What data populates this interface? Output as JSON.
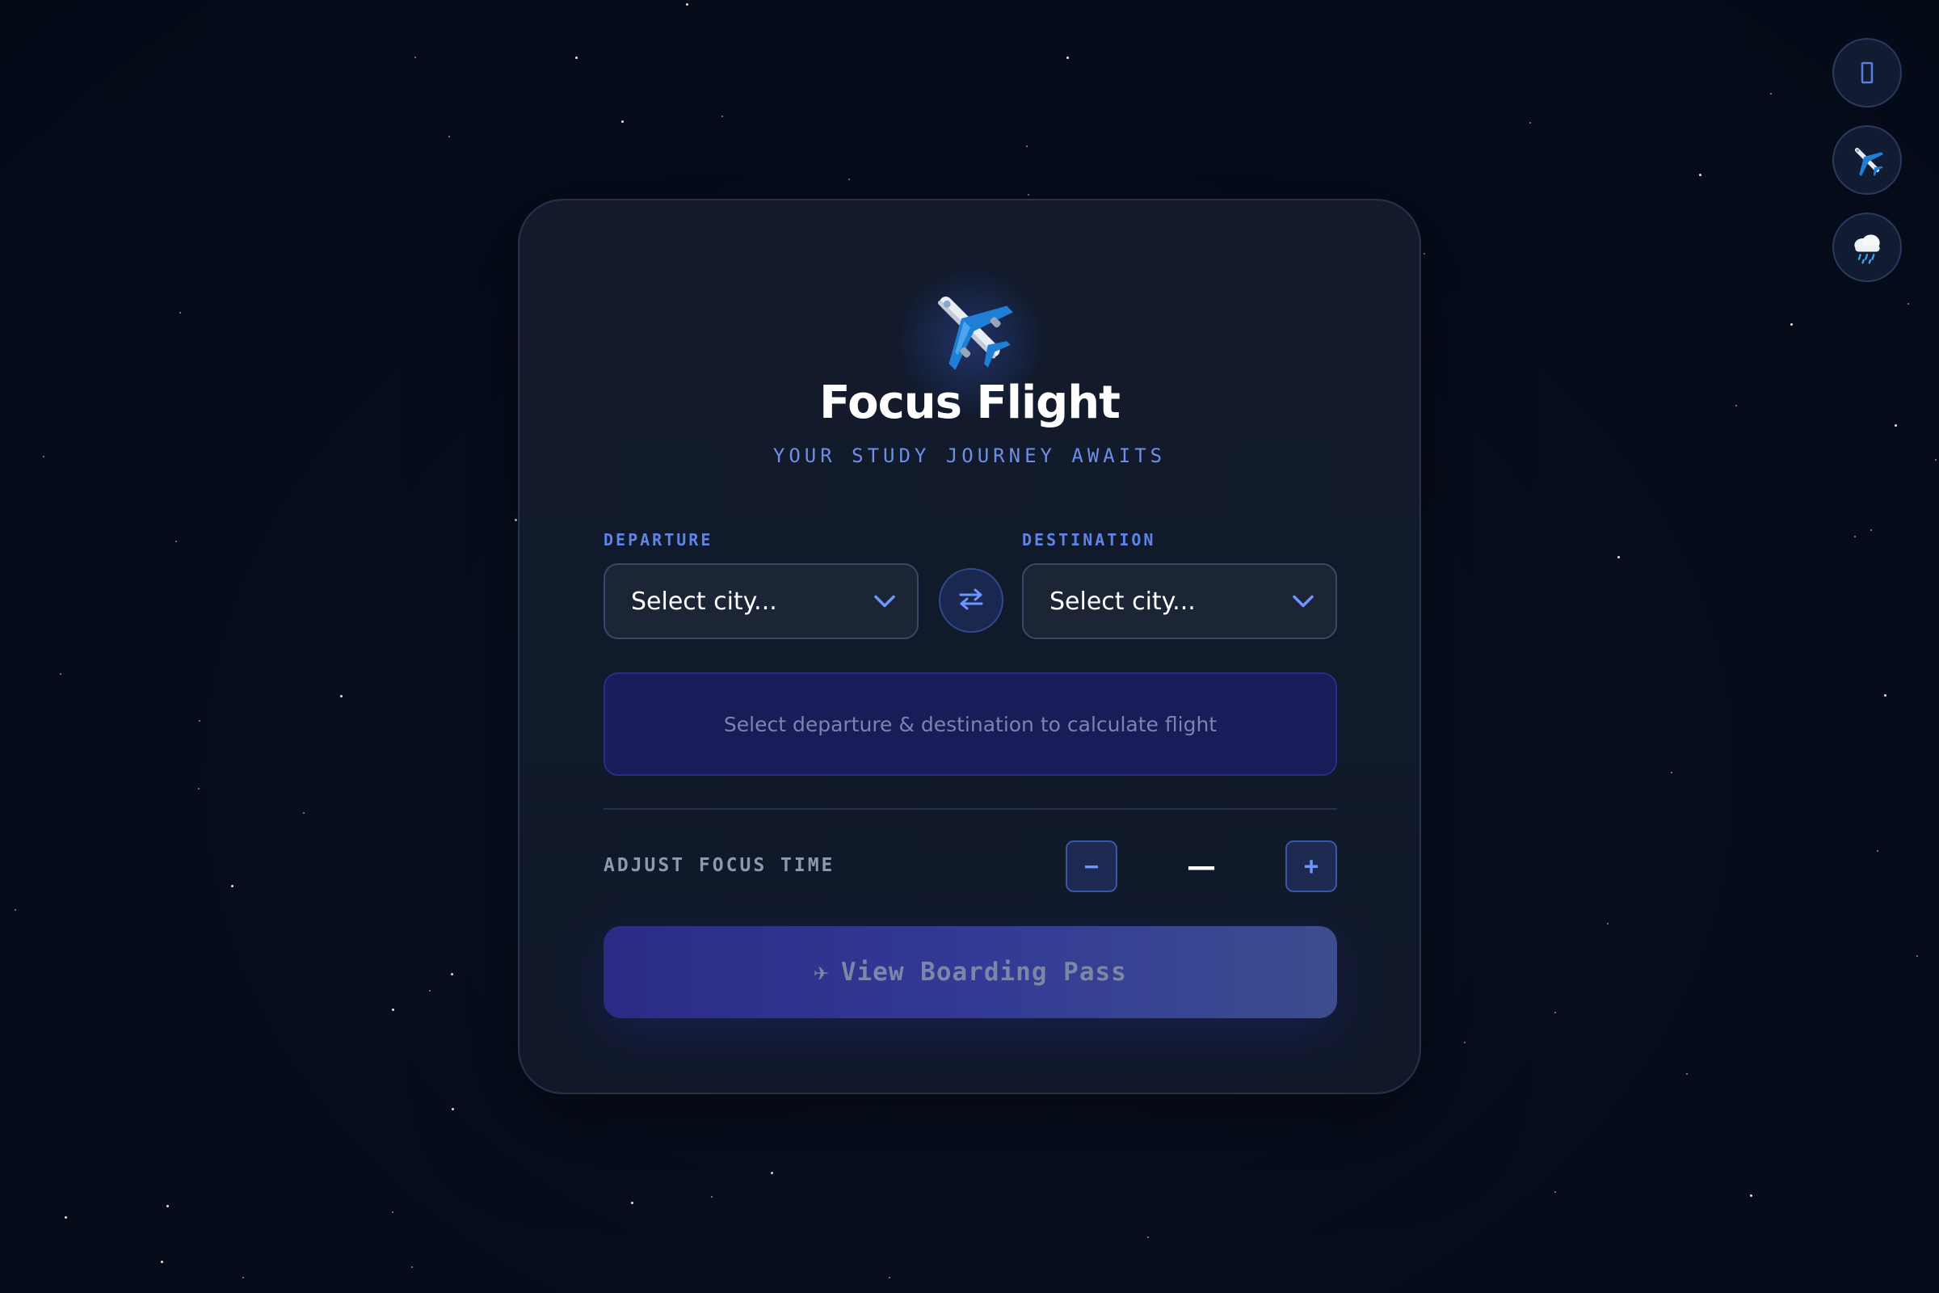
{
  "app": {
    "title": "Focus Flight",
    "subtitle": "YOUR STUDY JOURNEY AWAITS",
    "hero_icon": "airplane-icon"
  },
  "side_buttons": [
    {
      "icon": "empty-glyph-icon"
    },
    {
      "icon": "airplane-icon"
    },
    {
      "icon": "rain-cloud-icon"
    }
  ],
  "route": {
    "departure_label": "DEPARTURE",
    "departure_value": "Select city...",
    "destination_label": "DESTINATION",
    "destination_value": "Select city...",
    "swap_icon": "swap-arrows-icon"
  },
  "info": {
    "message": "Select departure & destination to calculate flight"
  },
  "focus": {
    "label": "ADJUST FOCUS TIME",
    "decrement": "−",
    "value": "—",
    "increment": "+"
  },
  "cta": {
    "icon": "✈",
    "label": "View Boarding Pass"
  },
  "colors": {
    "background": "#060c1c",
    "card": "#121a2c",
    "accent": "#6e8fe8",
    "info_box": "#181d5a",
    "cta_start": "#2b2b86",
    "cta_end": "#3c4d8f"
  }
}
